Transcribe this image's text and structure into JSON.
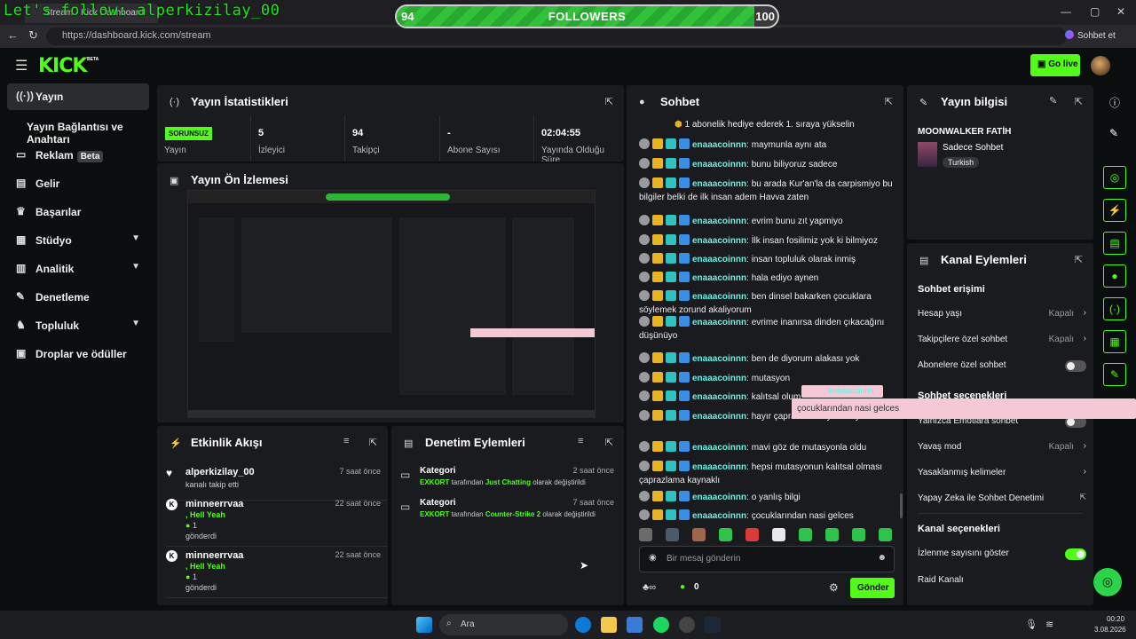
{
  "browser": {
    "tab_title": "Stream - Kick Dashboard",
    "url": "https://dashboard.kick.com/stream",
    "profile_label": "Sohbet et",
    "window_controls": [
      "minimize",
      "maximize",
      "close"
    ]
  },
  "overlay": {
    "streamer_text": "Let's follow: alperkizilay_00",
    "followers": {
      "label": "FOLLOWERS",
      "current": "94",
      "goal": "100",
      "progress_percent": 94
    }
  },
  "header": {
    "logo": "KICK",
    "logo_badge": "BETA",
    "go_live_label": "Go live"
  },
  "sidebar": {
    "items": [
      {
        "label": "Yayın",
        "icon": "broadcast-icon",
        "active": true
      },
      {
        "label": "Yayın Bağlantısı ve Anahtarı",
        "icon": "",
        "active": false
      },
      {
        "label": "Reklam",
        "icon": "ad-icon",
        "badge": "Beta"
      },
      {
        "label": "Gelir",
        "icon": "revenue-icon"
      },
      {
        "label": "Başarılar",
        "icon": "trophy-icon"
      },
      {
        "label": "Stüdyo",
        "icon": "studio-icon",
        "expandable": true
      },
      {
        "label": "Analitik",
        "icon": "analytics-icon",
        "expandable": true
      },
      {
        "label": "Denetleme",
        "icon": "wrench-icon"
      },
      {
        "label": "Topluluk",
        "icon": "community-icon",
        "expandable": true
      },
      {
        "label": "Droplar ve ödüller",
        "icon": "drops-icon"
      }
    ]
  },
  "stats": {
    "title": "Yayın İstatistikleri",
    "status_badge": "SORUNSUZ",
    "cells": [
      {
        "value": "",
        "label": "Yayın"
      },
      {
        "value": "5",
        "label": "İzleyici"
      },
      {
        "value": "94",
        "label": "Takipçi"
      },
      {
        "value": "-",
        "label": "Abone Sayısı"
      },
      {
        "value": "02:04:55",
        "label": "Yayında Olduğu Süre"
      }
    ]
  },
  "preview": {
    "title": "Yayın Ön İzlemesi"
  },
  "activity": {
    "title": "Etkinlik Akışı",
    "items": [
      {
        "name": "alperkizilay_00",
        "time": "7 saat önce",
        "line1": "kanalı takip etti",
        "line2": "",
        "line3": ""
      },
      {
        "name": "minneerrvaa",
        "time": "22 saat önce",
        "line1": ", Hell Yeah",
        "line2": "1",
        "line3": "gönderdi"
      },
      {
        "name": "minneerrvaa",
        "time": "22 saat önce",
        "line1": ", Hell Yeah",
        "line2": "1",
        "line3": "gönderdi"
      }
    ]
  },
  "moderation": {
    "title": "Denetim Eylemleri",
    "items": [
      {
        "title": "Kategori",
        "time": "2 saat önce",
        "actor": "EXKORT",
        "mid": "tarafından",
        "target": "Just Chatting",
        "end": "olarak değiştirildi"
      },
      {
        "title": "Kategori",
        "time": "7 saat önce",
        "actor": "EXKORT",
        "mid": "tarafından",
        "target": "Counter-Strike 2",
        "end": "olarak değiştirildi"
      }
    ]
  },
  "chat": {
    "title": "Sohbet",
    "pinned": "1 abonelik hediye ederek 1. sıraya yükselin",
    "username": "enaaacoinnn",
    "messages": [
      "maymunla aynı ata",
      "bunu biliyoruz sadece",
      "bu arada Kur'an'la da carpismiyo bu bilgiler belki de ilk insan adem Havva zaten",
      "evrim bunu zıt yapmiyo",
      "İlk insan fosilimiz yok ki bilmiyoz",
      "insan topluluk olarak inmiş",
      "hala ediyo aynen",
      "ben dinsel bakarken çocuklara söylemek zorund akaliyorum",
      "evrime inanırsa dinden çıkacağını düşünüyo",
      "ben de diyorum alakası yok",
      "mutasyon",
      "kalıtsal olum",
      "hayır çapraz mutasyon oluyo",
      "mavi göz de mutasyonla oldu",
      "hepsi mutasyonun kalıtsal olması çaprazlama kaynaklı",
      "o yanlış bilgi",
      "çocuklarından nasi gelces"
    ],
    "input_placeholder": "Bir mesaj gönderin",
    "points": "0",
    "send_label": "Gönder"
  },
  "popup": {
    "text": "çocuklarından nasi gelces",
    "user": "enaaacoinnn"
  },
  "stream_info": {
    "title": "Yayın bilgisi",
    "stream_title": "MOONWALKER FATİH",
    "category": "Sadece Sohbet",
    "tag": "Turkish"
  },
  "channel_actions": {
    "title": "Kanal Eylemleri",
    "chat_access_header": "Sohbet erişimi",
    "chat_access": [
      {
        "label": "Hesap yaşı",
        "value": "Kapalı"
      },
      {
        "label": "Takipçilere özel sohbet",
        "value": "Kapalı"
      },
      {
        "label": "Abonelere özel sohbet",
        "value": ""
      }
    ],
    "chat_options_header": "Sohbet seçenekleri",
    "chat_options": [
      {
        "label": "Yalnızca Emotlara sohbet",
        "value": ""
      },
      {
        "label": "Yavaş mod",
        "value": "Kapalı"
      },
      {
        "label": "Yasaklanmış kelimeler",
        "value": ""
      },
      {
        "label": "Yapay Zeka ile Sohbet Denetimi",
        "value": ""
      }
    ],
    "channel_options_header": "Kanal seçenekleri",
    "channel_options": [
      {
        "label": "İzlenme sayısını göster",
        "value": ""
      },
      {
        "label": "Raid Kanalı",
        "value": ""
      }
    ]
  },
  "taskbar": {
    "search_label": "Ara",
    "time": "00:20",
    "date": "3.08.2026"
  },
  "colors": {
    "accent": "#53fc18",
    "bg": "#0b0e0f",
    "panel": "#191b1f",
    "chat_user": "#6cf0e2"
  }
}
